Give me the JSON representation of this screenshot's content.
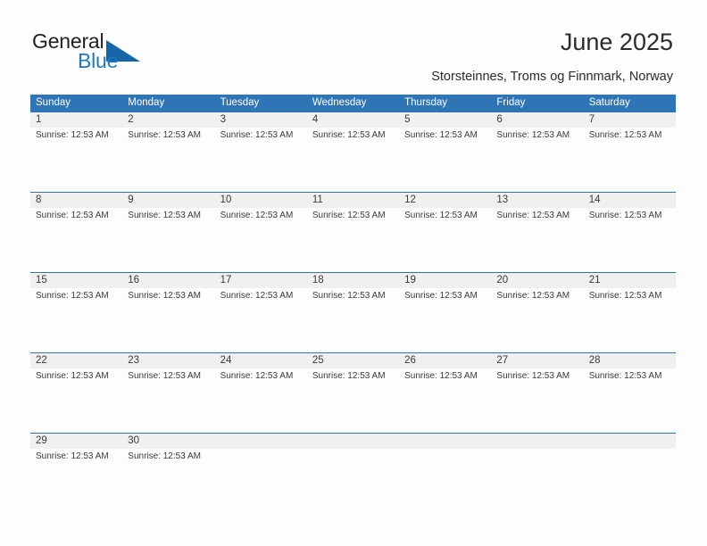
{
  "brand": {
    "name_part1": "General",
    "name_part2": "Blue",
    "triangle_icon": "triangle-logo-icon",
    "colors": {
      "dark_text": "#231f20",
      "blue_text": "#1c7ac0",
      "triangle": "#1565a8"
    }
  },
  "header": {
    "title": "June 2025",
    "subtitle": "Storsteinnes, Troms og Finnmark, Norway"
  },
  "theme": {
    "header_blue": "#2f74b5",
    "row_divider_blue": "#2f74b5",
    "daynum_band_gray": "#f0f0f0",
    "page_background": "#fdfdfd",
    "text": "#3a3a3a"
  },
  "calendar": {
    "weekdays": [
      "Sunday",
      "Monday",
      "Tuesday",
      "Wednesday",
      "Thursday",
      "Friday",
      "Saturday"
    ],
    "weeks": [
      {
        "days": [
          {
            "number": "1",
            "event": "Sunrise: 12:53 AM"
          },
          {
            "number": "2",
            "event": "Sunrise: 12:53 AM"
          },
          {
            "number": "3",
            "event": "Sunrise: 12:53 AM"
          },
          {
            "number": "4",
            "event": "Sunrise: 12:53 AM"
          },
          {
            "number": "5",
            "event": "Sunrise: 12:53 AM"
          },
          {
            "number": "6",
            "event": "Sunrise: 12:53 AM"
          },
          {
            "number": "7",
            "event": "Sunrise: 12:53 AM"
          }
        ]
      },
      {
        "days": [
          {
            "number": "8",
            "event": "Sunrise: 12:53 AM"
          },
          {
            "number": "9",
            "event": "Sunrise: 12:53 AM"
          },
          {
            "number": "10",
            "event": "Sunrise: 12:53 AM"
          },
          {
            "number": "11",
            "event": "Sunrise: 12:53 AM"
          },
          {
            "number": "12",
            "event": "Sunrise: 12:53 AM"
          },
          {
            "number": "13",
            "event": "Sunrise: 12:53 AM"
          },
          {
            "number": "14",
            "event": "Sunrise: 12:53 AM"
          }
        ]
      },
      {
        "days": [
          {
            "number": "15",
            "event": "Sunrise: 12:53 AM"
          },
          {
            "number": "16",
            "event": "Sunrise: 12:53 AM"
          },
          {
            "number": "17",
            "event": "Sunrise: 12:53 AM"
          },
          {
            "number": "18",
            "event": "Sunrise: 12:53 AM"
          },
          {
            "number": "19",
            "event": "Sunrise: 12:53 AM"
          },
          {
            "number": "20",
            "event": "Sunrise: 12:53 AM"
          },
          {
            "number": "21",
            "event": "Sunrise: 12:53 AM"
          }
        ]
      },
      {
        "days": [
          {
            "number": "22",
            "event": "Sunrise: 12:53 AM"
          },
          {
            "number": "23",
            "event": "Sunrise: 12:53 AM"
          },
          {
            "number": "24",
            "event": "Sunrise: 12:53 AM"
          },
          {
            "number": "25",
            "event": "Sunrise: 12:53 AM"
          },
          {
            "number": "26",
            "event": "Sunrise: 12:53 AM"
          },
          {
            "number": "27",
            "event": "Sunrise: 12:53 AM"
          },
          {
            "number": "28",
            "event": "Sunrise: 12:53 AM"
          }
        ]
      },
      {
        "days": [
          {
            "number": "29",
            "event": "Sunrise: 12:53 AM"
          },
          {
            "number": "30",
            "event": "Sunrise: 12:53 AM"
          },
          {
            "number": "",
            "event": ""
          },
          {
            "number": "",
            "event": ""
          },
          {
            "number": "",
            "event": ""
          },
          {
            "number": "",
            "event": ""
          },
          {
            "number": "",
            "event": ""
          }
        ]
      }
    ]
  }
}
